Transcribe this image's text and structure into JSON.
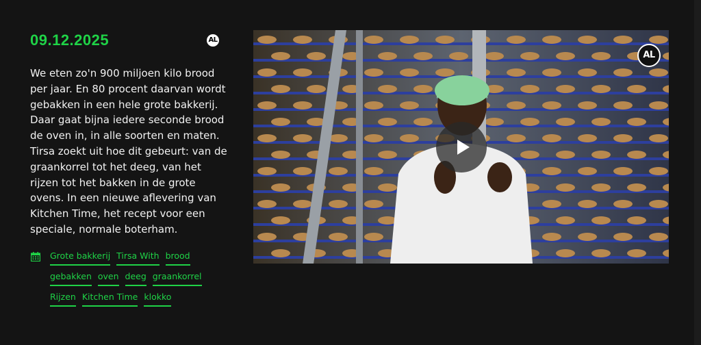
{
  "episode": {
    "date": "09.12.2025",
    "channel_logo": "AL",
    "description": "We eten zo'n 900 miljoen kilo brood per jaar. En 80 procent daarvan wordt gebakken in een hele grote bakkerij. Daar gaat bijna iedere seconde brood de oven in, in alle soorten en maten. Tirsa zoekt uit hoe dit gebeurt: van de graankorrel tot het deeg, van het rijzen tot het bakken in de grote ovens. In een nieuwe aflevering van Kitchen Time, het recept voor een speciale, normale boterham.",
    "tags": [
      "Grote bakkerij",
      "Tirsa With",
      "brood",
      "gebakken",
      "oven",
      "deeg",
      "graankorrel",
      "Rijzen",
      "Kitchen Time",
      "klokko"
    ]
  },
  "video": {
    "watermark": "AL",
    "play_icon": "play-icon"
  },
  "colors": {
    "background": "#141414",
    "accent": "#1fd347",
    "text": "#f2f2f2"
  }
}
